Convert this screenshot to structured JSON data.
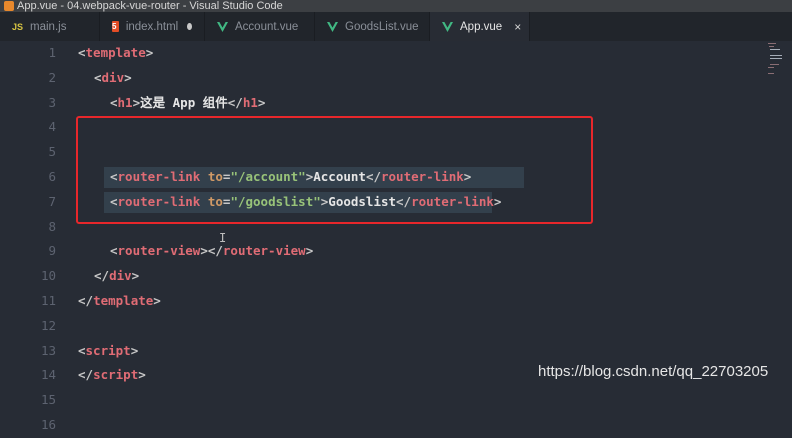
{
  "window": {
    "title": "App.vue - 04.webpack-vue-router - Visual Studio Code"
  },
  "tabs": [
    {
      "label": "main.js",
      "icon": "js-icon",
      "icon_text": "JS",
      "active": false
    },
    {
      "label": "index.html",
      "icon": "html-file-icon",
      "icon_text": "5",
      "active": false,
      "unsaved": true
    },
    {
      "label": "Account.vue",
      "icon": "vue-icon",
      "active": false
    },
    {
      "label": "GoodsList.vue",
      "icon": "vue-icon",
      "active": false
    },
    {
      "label": "App.vue",
      "icon": "vue-icon",
      "active": true,
      "close_symbol": "×"
    }
  ],
  "line_numbers": [
    "1",
    "2",
    "3",
    "4",
    "5",
    "6",
    "7",
    "8",
    "9",
    "10",
    "11",
    "12",
    "13",
    "14",
    "15",
    "16"
  ],
  "code": {
    "l1": {
      "open": "<",
      "tag": "template",
      "close": ">"
    },
    "l2": {
      "open": "<",
      "tag": "div",
      "close": ">"
    },
    "l3": {
      "open": "<",
      "tag": "h1",
      "mid": ">",
      "text": "这是 App 组件",
      "end_open": "</",
      "end_tag": "h1",
      "end_close": ">"
    },
    "l6": {
      "open": "<",
      "tag": "router-link",
      "attr": "to",
      "eq": "=",
      "value": "\"/account\"",
      "mid": ">",
      "text": "Account",
      "end_open": "</",
      "end_tag": "router-link",
      "end_close": ">"
    },
    "l7": {
      "open": "<",
      "tag": "router-link",
      "attr": "to",
      "eq": "=",
      "value": "\"/goodslist\"",
      "mid": ">",
      "text": "Goodslist",
      "end_open": "</",
      "end_tag": "router-link",
      "end_close": ">"
    },
    "l9": {
      "open": "<",
      "tag": "router-view",
      "mid": "></",
      "end_tag": "router-view",
      "end_close": ">"
    },
    "l10": {
      "open": "</",
      "tag": "div",
      "close": ">"
    },
    "l11": {
      "open": "</",
      "tag": "template",
      "close": ">"
    },
    "l13": {
      "open": "<",
      "tag": "script",
      "close": ">"
    },
    "l14": {
      "open": "</",
      "tag": "script",
      "close": ">"
    }
  },
  "cursor_glyph": "I",
  "watermark": "https://blog.csdn.net/qq_22703205",
  "colors": {
    "accent_red": "#e8272b",
    "vue_green": "#41b883",
    "tag": "#e06c75",
    "string": "#98c379",
    "attr": "#d19a66"
  }
}
